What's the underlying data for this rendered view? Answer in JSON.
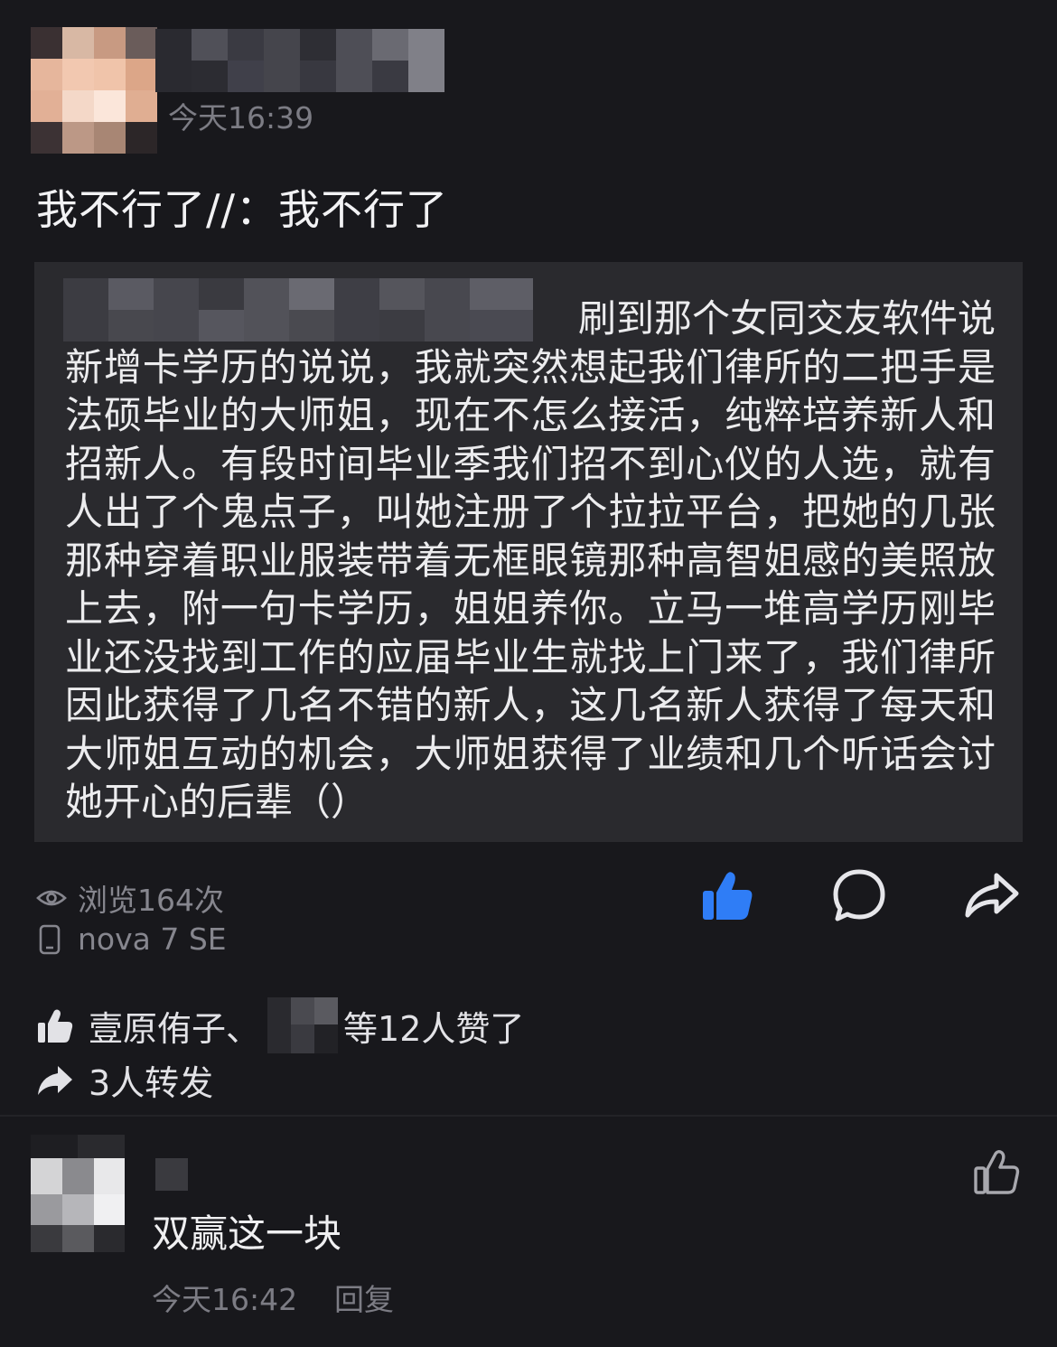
{
  "post": {
    "time": "今天16:39",
    "text": "我不行了//：我不行了"
  },
  "quote": {
    "text": "刷到那个女同交友软件说新增卡学历的说说，我就突然想起我们律所的二把手是法硕毕业的大师姐，现在不怎么接活，纯粹培养新人和招新人。有段时间毕业季我们招不到心仪的人选，就有人出了个鬼点子，叫她注册了个拉拉平台，把她的几张那种穿着职业服装带着无框眼镜那种高智姐感的美照放上去，附一句卡学历，姐姐养你。立马一堆高学历刚毕业还没找到工作的应届毕业生就找上门来了，我们律所因此获得了几名不错的新人，这几名新人获得了每天和大师姐互动的机会，大师姐获得了业绩和几个听话会讨她开心的后辈（）"
  },
  "meta": {
    "views": "浏览164次",
    "device": "nova 7 SE"
  },
  "actions": {
    "like_icon": "thumbs-up-filled-icon",
    "comment_icon": "comment-bubble-icon",
    "share_icon": "share-arrow-icon",
    "like_color": "#2f7df6"
  },
  "likes": {
    "name": "壹原侑子、",
    "suffix": "等12人赞了"
  },
  "shares": {
    "text": "3人转发"
  },
  "comment": {
    "text": "双赢这一块",
    "time": "今天16:42",
    "reply_label": "回复"
  }
}
